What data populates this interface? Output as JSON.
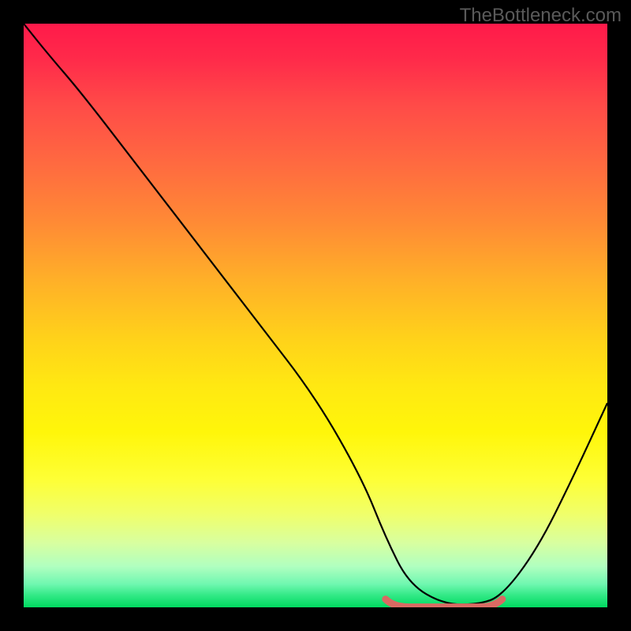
{
  "watermark": "TheBottleneck.com",
  "chart_data": {
    "type": "line",
    "title": "",
    "xlabel": "",
    "ylabel": "",
    "xlim": [
      0,
      100
    ],
    "ylim": [
      0,
      100
    ],
    "series": [
      {
        "name": "bottleneck-curve",
        "x": [
          0,
          4,
          10,
          20,
          30,
          40,
          50,
          58,
          62,
          66,
          72,
          78,
          82,
          88,
          94,
          100
        ],
        "y": [
          100,
          95,
          88,
          75,
          62,
          49,
          36,
          22,
          12,
          4,
          0.5,
          0.5,
          2,
          10,
          22,
          35
        ]
      }
    ],
    "annotations": [
      {
        "name": "optimal-flat-segment",
        "x_start": 62,
        "x_end": 82,
        "y": 0.6
      }
    ],
    "background_gradient": {
      "top": "#ff1a4a",
      "mid": "#ffe812",
      "bottom": "#00db60"
    }
  }
}
